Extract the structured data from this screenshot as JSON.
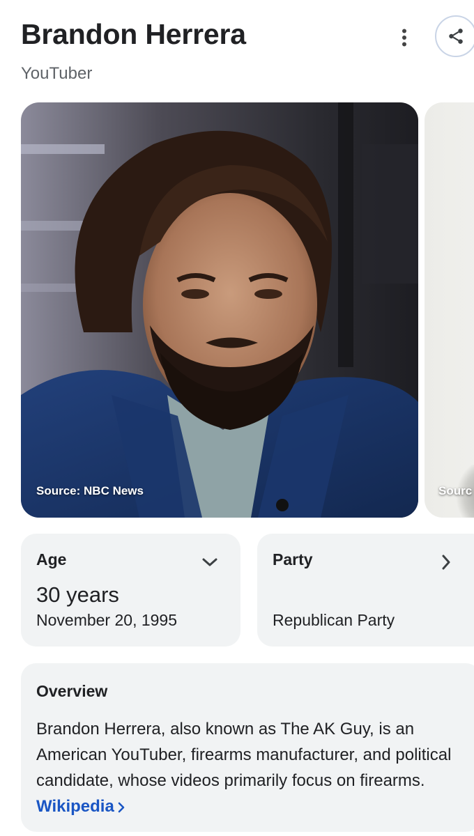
{
  "header": {
    "name": "Brandon Herrera",
    "subtitle": "YouTuber"
  },
  "actions": {
    "more_icon": "more-vert-icon",
    "share_icon": "share-icon"
  },
  "images": [
    {
      "source": "Source: NBC News"
    },
    {
      "source": "Sourc"
    }
  ],
  "facts": {
    "age": {
      "label": "Age",
      "value": "30 years",
      "detail": "November 20, 1995"
    },
    "party": {
      "label": "Party",
      "value": "Republican Party"
    }
  },
  "overview": {
    "title": "Overview",
    "text": "Brandon Herrera, also known as The AK Guy, is an American YouTuber, firearms manufacturer, and political candidate, whose videos primarily focus on firearms.",
    "link_label": "Wikipedia"
  },
  "colors": {
    "link": "#1a56c4",
    "card_bg": "#f1f3f4",
    "text": "#202124",
    "muted": "#5f6368"
  }
}
